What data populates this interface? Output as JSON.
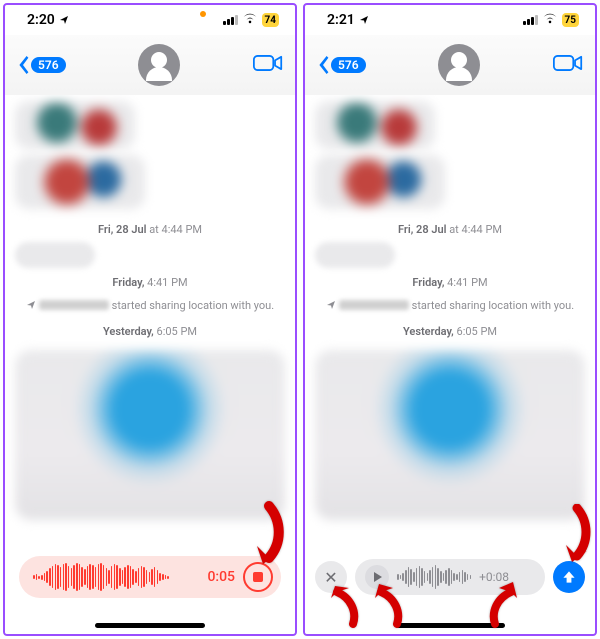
{
  "leftPhone": {
    "statusBar": {
      "time": "2:20",
      "locationActive": true,
      "battery": "74"
    },
    "nav": {
      "backBadge": "576"
    },
    "timestamps": {
      "ts1_day": "Fri, 28 Jul",
      "ts1_time": "at 4:44 PM",
      "ts2_day": "Friday,",
      "ts2_time": "4:41 PM",
      "locationText": "started sharing location with you.",
      "ts3_day": "Yesterday,",
      "ts3_time": "6:05 PM"
    },
    "recording": {
      "elapsed": "0:05",
      "waveformBars": [
        4,
        6,
        3,
        5,
        8,
        12,
        18,
        22,
        26,
        24,
        20,
        26,
        28,
        22,
        18,
        24,
        28,
        26,
        20,
        16,
        22,
        26,
        24,
        20,
        26,
        28,
        24,
        18,
        14,
        22,
        26,
        24,
        18,
        14,
        20,
        24,
        22,
        16,
        12,
        18,
        22,
        20,
        14,
        10,
        16,
        20,
        14,
        8,
        6,
        4,
        3
      ]
    }
  },
  "rightPhone": {
    "statusBar": {
      "time": "2:21",
      "locationActive": true,
      "battery": "75"
    },
    "nav": {
      "backBadge": "576"
    },
    "timestamps": {
      "ts1_day": "Fri, 28 Jul",
      "ts1_time": "at 4:44 PM",
      "ts2_day": "Friday,",
      "ts2_time": "4:41 PM",
      "locationText": "started sharing location with you.",
      "ts3_day": "Yesterday,",
      "ts3_time": "6:05 PM"
    },
    "playback": {
      "durationPrefix": "+",
      "duration": "0:08",
      "waveformBars": [
        6,
        4,
        8,
        14,
        20,
        16,
        10,
        18,
        22,
        18,
        12,
        8,
        14,
        20,
        24,
        18,
        12,
        8,
        14,
        18,
        14,
        8,
        6,
        10,
        14,
        10,
        6,
        4
      ]
    }
  }
}
